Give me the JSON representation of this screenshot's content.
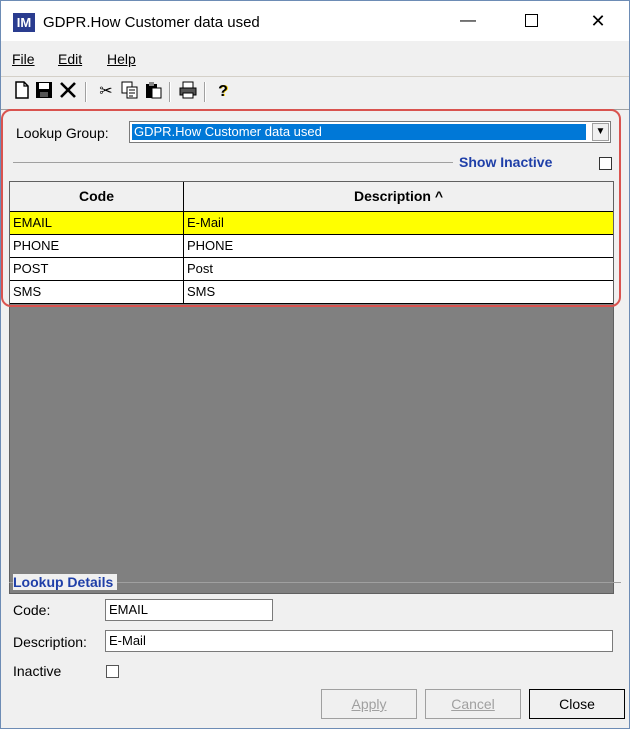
{
  "window": {
    "title": "GDPR.How Customer data used",
    "icon_letter": "IM"
  },
  "menu": [
    {
      "label": "File"
    },
    {
      "label": "Edit"
    },
    {
      "label": "Help"
    }
  ],
  "toolbar": {
    "icons": [
      "new-icon",
      "save-icon",
      "delete-icon",
      "cut-icon",
      "copy-icon",
      "paste-icon",
      "print-icon",
      "help-icon"
    ]
  },
  "lookup": {
    "group_label": "Lookup Group:",
    "group_value": "GDPR.How Customer data used",
    "show_inactive_label": "Show Inactive"
  },
  "grid": {
    "columns": [
      "Code",
      "Description ^"
    ],
    "rows": [
      {
        "code": "EMAIL",
        "description": "E-Mail"
      },
      {
        "code": "PHONE",
        "description": "PHONE"
      },
      {
        "code": "POST",
        "description": "Post"
      },
      {
        "code": "SMS",
        "description": "SMS"
      }
    ]
  },
  "details": {
    "title": "Lookup Details",
    "code_label": "Code:",
    "code_value": "EMAIL",
    "description_label": "Description:",
    "description_value": "E-Mail",
    "inactive_label": "Inactive"
  },
  "buttons": {
    "apply": "Apply",
    "cancel": "Cancel",
    "close": "Close"
  },
  "colors": {
    "selected_row": "#ffff00",
    "highlight_border": "#d9534f",
    "section_title": "#1f3fa8",
    "select_value_bg": "#0078d7"
  }
}
